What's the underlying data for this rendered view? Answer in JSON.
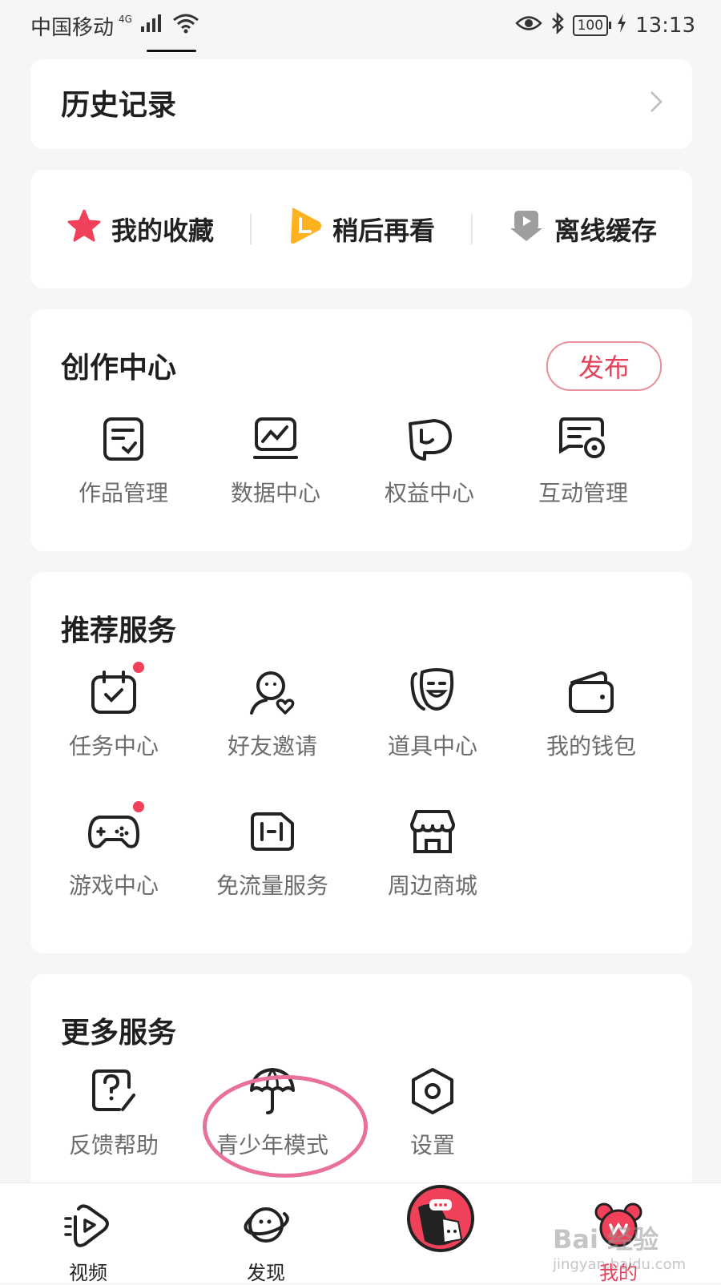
{
  "status_bar": {
    "carrier": "中国移动",
    "network": "4G",
    "battery": "100",
    "time": "13:13"
  },
  "history": {
    "title": "历史记录"
  },
  "quick_links": [
    {
      "label": "我的收藏",
      "icon": "star-icon",
      "color": "#f1415a"
    },
    {
      "label": "稍后再看",
      "icon": "watch-later-icon",
      "color": "#ffb21f"
    },
    {
      "label": "离线缓存",
      "icon": "download-icon",
      "color": "#9e9e9e"
    }
  ],
  "creation_center": {
    "title": "创作中心",
    "publish_label": "发布",
    "items": [
      {
        "label": "作品管理",
        "icon": "works-manage-icon"
      },
      {
        "label": "数据中心",
        "icon": "data-chart-icon"
      },
      {
        "label": "权益中心",
        "icon": "rights-shield-icon"
      },
      {
        "label": "互动管理",
        "icon": "interaction-manage-icon"
      }
    ]
  },
  "recommended_services": {
    "title": "推荐服务",
    "items": [
      {
        "label": "任务中心",
        "icon": "calendar-check-icon",
        "badge": true
      },
      {
        "label": "好友邀请",
        "icon": "friend-invite-icon",
        "badge": false
      },
      {
        "label": "道具中心",
        "icon": "mask-icon",
        "badge": false
      },
      {
        "label": "我的钱包",
        "icon": "wallet-icon",
        "badge": false
      },
      {
        "label": "游戏中心",
        "icon": "gamepad-icon",
        "badge": true
      },
      {
        "label": "免流量服务",
        "icon": "sim-card-icon",
        "badge": false
      },
      {
        "label": "周边商城",
        "icon": "store-icon",
        "badge": false
      }
    ]
  },
  "more_services": {
    "title": "更多服务",
    "items": [
      {
        "label": "反馈帮助",
        "icon": "help-feedback-icon"
      },
      {
        "label": "青少年模式",
        "icon": "umbrella-icon"
      },
      {
        "label": "设置",
        "icon": "settings-hex-icon"
      }
    ]
  },
  "tab_bar": {
    "tabs": [
      {
        "label": "视频",
        "icon": "video-tab-icon",
        "active": false
      },
      {
        "label": "发现",
        "icon": "planet-tab-icon",
        "active": false
      },
      {
        "label": "",
        "icon": "center-mascot-icon",
        "active": false
      },
      {
        "label": "我的",
        "icon": "mine-tab-icon",
        "active": true
      }
    ],
    "active_color": "#e5405a"
  },
  "watermark": {
    "line1": "Bai 经验",
    "line2": "jingyan.baidu.com"
  }
}
